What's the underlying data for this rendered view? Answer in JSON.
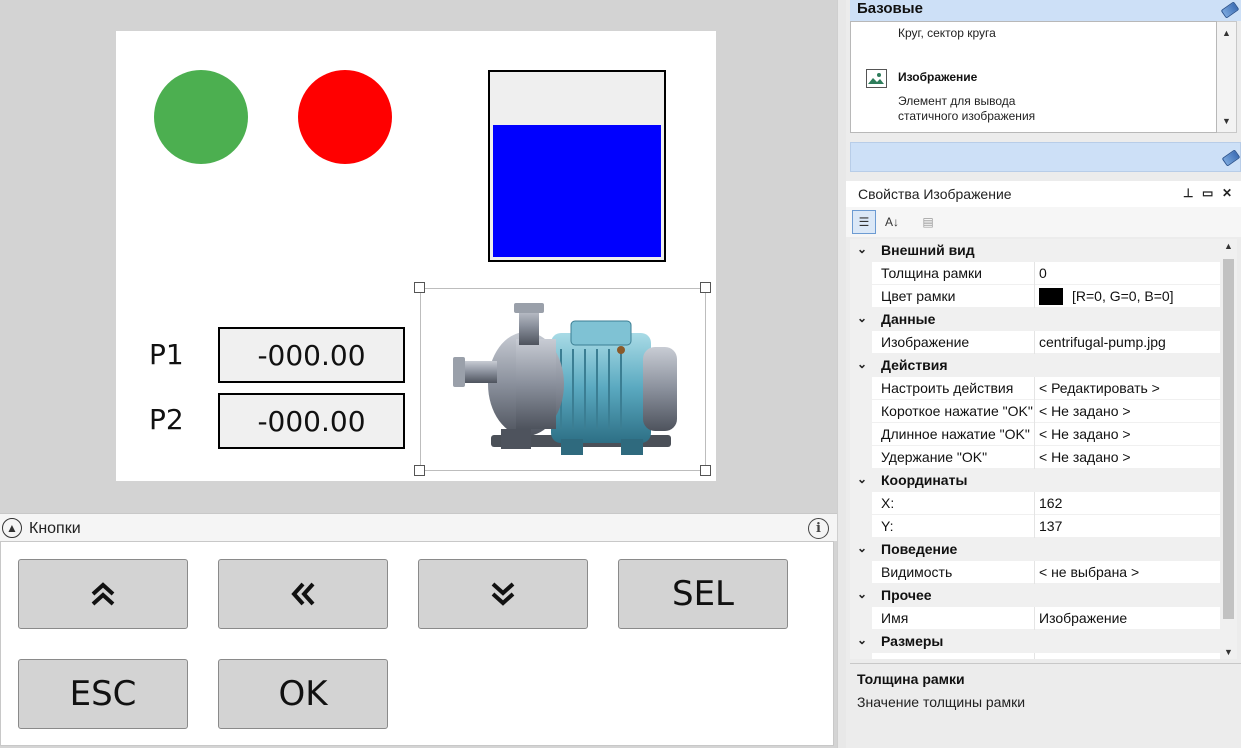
{
  "screen": {
    "lamp_green_color": "#4caf50",
    "lamp_red_color": "#ff0000",
    "tank_fill_color": "#0000ff",
    "tank_level": 0.72,
    "p1": {
      "label": "P1",
      "value": "-000.00"
    },
    "p2": {
      "label": "P2",
      "value": "-000.00"
    },
    "image_icon": "centrifugal-pump-image"
  },
  "buttons_panel": {
    "title": "Кнопки",
    "info_icon": "info-icon",
    "buttons": {
      "up": "up-double-chevron-icon",
      "left": "left-double-chevron-icon",
      "down": "down-double-chevron-icon",
      "sel": "SEL",
      "esc": "ESC",
      "ok": "OK"
    }
  },
  "toolbox": {
    "group": "Базовые",
    "item_circle_desc": "Круг, сектор круга",
    "item_image_name": "Изображение",
    "item_image_desc_1": "Элемент для вывода",
    "item_image_desc_2": "статичного изображения"
  },
  "properties": {
    "title": "Свойства Изображение",
    "pin_icon": "pin-icon",
    "rows": [
      {
        "type": "cat",
        "name": "Внешний вид"
      },
      {
        "type": "prop",
        "name": "Толщина рамки",
        "value": "0"
      },
      {
        "type": "color",
        "name": "Цвет рамки",
        "value": "[R=0, G=0, B=0]"
      },
      {
        "type": "cat",
        "name": "Данные"
      },
      {
        "type": "prop",
        "name": "Изображение",
        "value": "centrifugal-pump.jpg"
      },
      {
        "type": "cat",
        "name": "Действия"
      },
      {
        "type": "prop",
        "name": "Настроить действия",
        "value": "< Редактировать >"
      },
      {
        "type": "prop",
        "name": "Короткое нажатие \"OK\"",
        "value": "< Не задано >"
      },
      {
        "type": "prop",
        "name": "Длинное нажатие \"OK\"",
        "value": "< Не задано >"
      },
      {
        "type": "prop",
        "name": "Удержание \"OK\"",
        "value": "< Не задано >"
      },
      {
        "type": "cat",
        "name": "Координаты"
      },
      {
        "type": "prop",
        "name": "X:",
        "value": "162"
      },
      {
        "type": "prop",
        "name": "Y:",
        "value": "137"
      },
      {
        "type": "cat",
        "name": "Поведение"
      },
      {
        "type": "prop",
        "name": "Видимость",
        "value": "< не выбрана >"
      },
      {
        "type": "cat",
        "name": "Прочее"
      },
      {
        "type": "prop",
        "name": "Имя",
        "value": "Изображение"
      },
      {
        "type": "cat",
        "name": "Размеры"
      },
      {
        "type": "prop",
        "name": "",
        "value": ""
      }
    ],
    "description": {
      "title": "Толщина рамки",
      "text": "Значение толщины рамки"
    }
  }
}
